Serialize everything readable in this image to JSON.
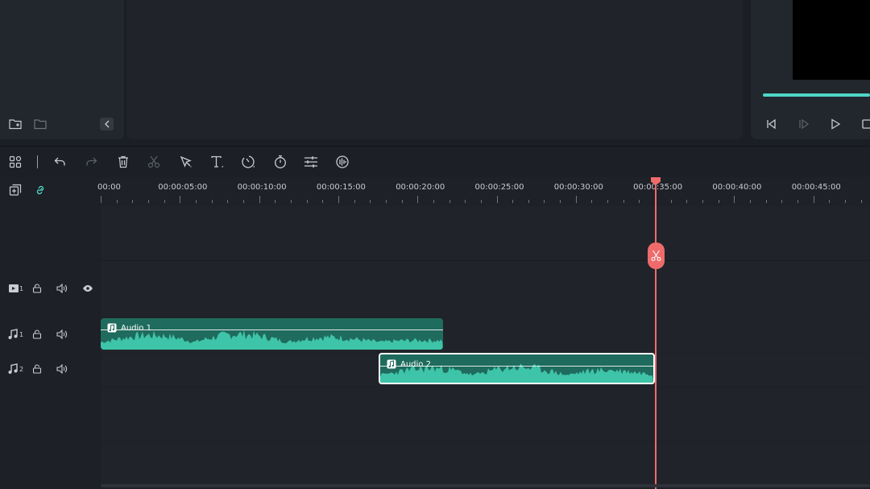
{
  "media_panel": {
    "buttons": [
      "new-folder-icon",
      "folder-icon",
      "collapse-left-icon"
    ]
  },
  "player": {
    "progress_percent": 100,
    "controls": [
      "step-back-icon",
      "step-forward-icon",
      "play-icon",
      "stop-icon"
    ],
    "accent": "#4fd6c6"
  },
  "toolbar": {
    "tools": [
      "layout-grid-icon",
      "undo-icon",
      "redo-icon",
      "delete-icon",
      "cut-icon",
      "select-tool-icon",
      "text-tool-icon",
      "speed-icon",
      "timer-icon",
      "adjust-icon",
      "audio-record-icon"
    ]
  },
  "timeline": {
    "ruler_labels": [
      "00:00:00",
      "00:00:05:00",
      "00:00:10:00",
      "00:00:15:00",
      "00:00:20:00",
      "00:00:25:00",
      "00:00:30:00",
      "00:00:35:00",
      "00:00:40:00",
      "00:00:45:00"
    ],
    "tracks": [
      {
        "kind": "video",
        "number": "1"
      },
      {
        "kind": "audio",
        "number": "1"
      },
      {
        "kind": "audio",
        "number": "2"
      }
    ],
    "clips": [
      {
        "name": "Audio 1",
        "track": "audio-1",
        "start": "00:00:00",
        "end": "00:00:21:20",
        "selected": false
      },
      {
        "name": "Audio 2",
        "track": "audio-2",
        "start": "00:00:17:15",
        "end": "00:00:35:00",
        "selected": true
      }
    ],
    "playhead": "00:00:35:00",
    "colors": {
      "clip": "#3ec4a8",
      "playhead": "#ef6b6b"
    }
  }
}
